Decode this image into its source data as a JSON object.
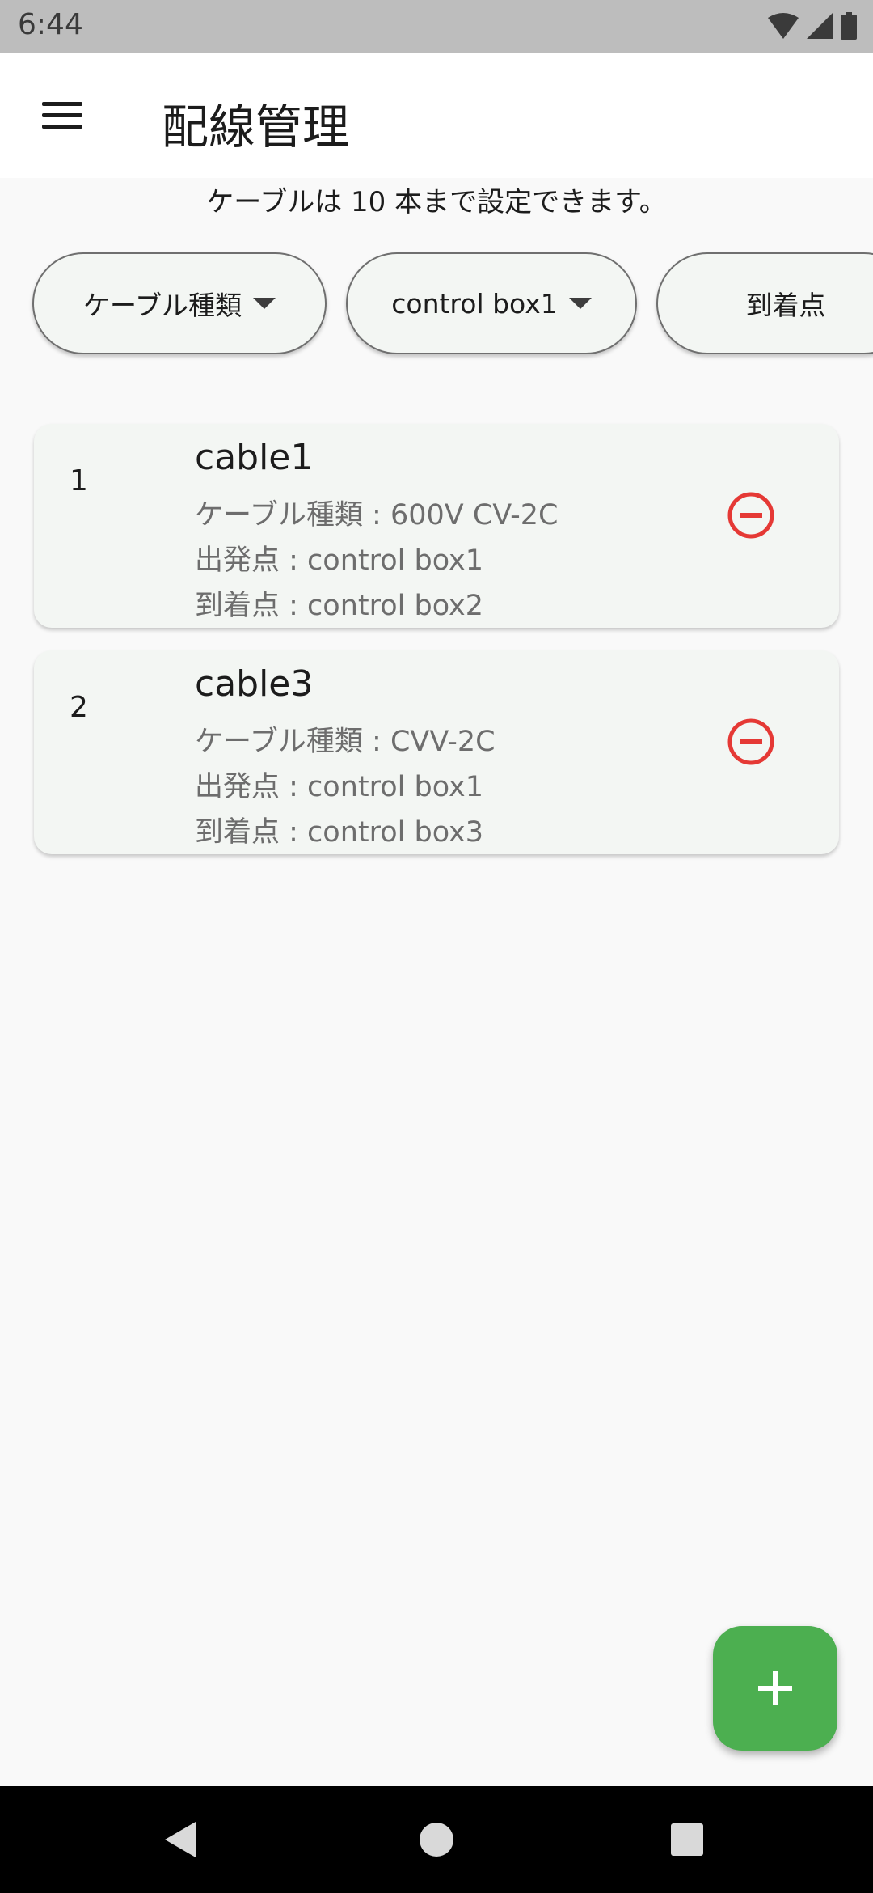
{
  "status_bar": {
    "time": "6:44",
    "icons": [
      "wifi-icon",
      "signal-icon",
      "battery-icon"
    ]
  },
  "app_bar": {
    "title": "配線管理",
    "menu_icon": "menu-icon"
  },
  "info_text": "ケーブルは 10 本まで設定できます。",
  "filters": [
    {
      "label": "ケーブル種類",
      "has_dropdown": true
    },
    {
      "label": "control box1",
      "has_dropdown": true
    },
    {
      "label": "到着点",
      "has_dropdown": false
    }
  ],
  "cables": [
    {
      "index": "1",
      "name": "cable1",
      "type_line": "ケーブル種類 : 600V CV-2C",
      "from_line": "出発点 : control box1",
      "to_line": "到着点 : control box2"
    },
    {
      "index": "2",
      "name": "cable3",
      "type_line": "ケーブル種類 : CVV-2C",
      "from_line": "出発点 : control box1",
      "to_line": "到着点 : control box3"
    }
  ],
  "fab": {
    "icon": "plus-icon"
  },
  "colors": {
    "accent_green": "#4caf50",
    "remove_red": "#e53935",
    "status_bar": "#bdbdbd"
  }
}
